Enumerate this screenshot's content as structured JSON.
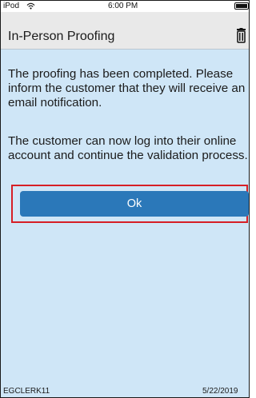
{
  "status_bar": {
    "device": "iPod",
    "time": "6:00 PM",
    "wifi_icon": "wifi-icon",
    "battery_icon": "battery-icon"
  },
  "header": {
    "title": "In-Person Proofing",
    "trash_icon": "trash-icon"
  },
  "content": {
    "message_completed": "The proofing has been completed. Please inform the customer that they will receive an email notification.",
    "message_next": "The customer can now log into their online account and continue the validation process."
  },
  "actions": {
    "ok_label": "Ok"
  },
  "footer": {
    "user_id": "EGCLERK11",
    "date": "5/22/2019"
  },
  "colors": {
    "page_background": "#cfe6f7",
    "header_background": "#e9e9e9",
    "button_blue": "#2b78b9",
    "highlight_red": "#d61f26",
    "text": "#1b1b1b"
  }
}
